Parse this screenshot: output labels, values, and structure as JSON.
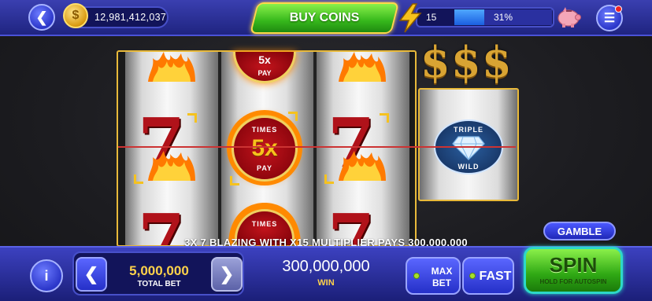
{
  "header": {
    "coin_balance": "12,981,412,037",
    "buy_coins_label": "BUY COINS",
    "level": "15",
    "level_progress_text": "31%",
    "level_progress": 0.31
  },
  "reels": {
    "multiplier_symbol": {
      "top": "TIMES",
      "middle": "5x",
      "bottom": "PAY"
    },
    "partial_top_symbol": {
      "middle": "5x",
      "bottom": "PAY"
    },
    "partial_bottom_symbol": {
      "top": "TIMES"
    },
    "seven_symbol": "7",
    "side_reel_header": "$$$",
    "wild_symbol": {
      "top": "TRIPLE",
      "bottom": "WILD"
    }
  },
  "message": "3X 7 BLAZING WITH X15 MULTIPLIER PAYS 300,000,000",
  "gamble_label": "GAMBLE",
  "bottom": {
    "total_bet_value": "5,000,000",
    "total_bet_label": "TOTAL BET",
    "win_value": "300,000,000",
    "win_label": "WIN",
    "max_bet_label_line1": "MAX",
    "max_bet_label_line2": "BET",
    "fast_label": "FAST",
    "spin_label": "SPIN",
    "spin_sublabel": "HOLD FOR AUTOSPIN",
    "info_label": "i"
  },
  "colors": {
    "accent_gold": "#e8b93a",
    "spin_green": "#36b81c",
    "ui_blue": "#2b36c9",
    "seven_red": "#b0121a"
  }
}
